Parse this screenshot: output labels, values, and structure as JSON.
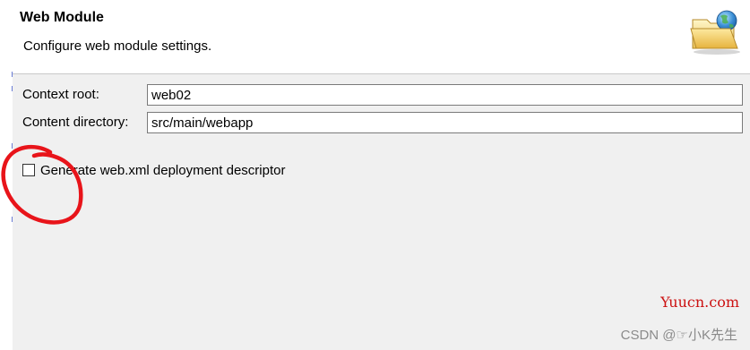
{
  "header": {
    "title": "Web Module",
    "subtitle": "Configure web module settings.",
    "icon": "folder-globe-icon"
  },
  "form": {
    "context_root": {
      "label": "Context root:",
      "value": "web02"
    },
    "content_directory": {
      "label": "Content directory:",
      "value": "src/main/webapp"
    },
    "generate_descriptor": {
      "label": "Generate web.xml deployment descriptor",
      "checked": false
    }
  },
  "annotation": {
    "color": "#e8141a",
    "shape": "hand-drawn-circle"
  },
  "watermark": {
    "site": "Yuucn.com",
    "credit": "CSDN @☞小K先生"
  }
}
